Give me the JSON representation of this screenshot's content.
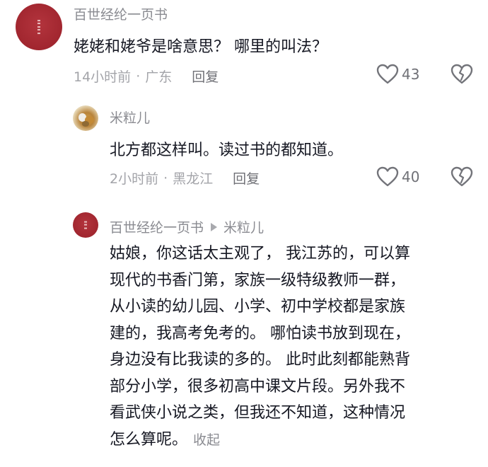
{
  "comments": [
    {
      "username": "百世经纶一页书",
      "text": "姥姥和姥爷是啥意思？   哪里的叫法？",
      "time": "14小时前",
      "location": "广东",
      "reply_label": "回复",
      "likes": "43",
      "avatar": "red-seal-avatar"
    },
    {
      "username": "米粒儿",
      "text": "北方都这样叫。读过书的都知道。",
      "time": "2小时前",
      "location": "黑龙江",
      "reply_label": "回复",
      "likes": "40",
      "avatar": "pet-photo-avatar"
    },
    {
      "username": "百世经纶一页书",
      "reply_to": "米粒儿",
      "lines": [
        "姑娘，你这话太主观了，  我江苏的，可以算",
        "现代的书香门第，家族一级特级教师一群，",
        "从小读的幼儿园、小学、初中学校都是家族",
        "建的，我高考免考的。 哪怕读书放到现在，",
        "身边没有比我读的多的。 此时此刻都能熟背",
        "部分小学，很多初高中课文片段。另外我不",
        "看武侠小说之类，但我还不知道，这种情况",
        "怎么算呢。"
      ],
      "collapse_label": "收起",
      "avatar": "red-seal-avatar"
    }
  ],
  "icons": {
    "like": "heart-outline-icon",
    "dislike": "broken-heart-icon",
    "reply_arrow": "play-triangle-icon"
  },
  "colors": {
    "text_primary": "#161823",
    "text_secondary": "#8a8b91",
    "text_meta": "#a3a4a9",
    "avatar_red": "#a1262f"
  }
}
